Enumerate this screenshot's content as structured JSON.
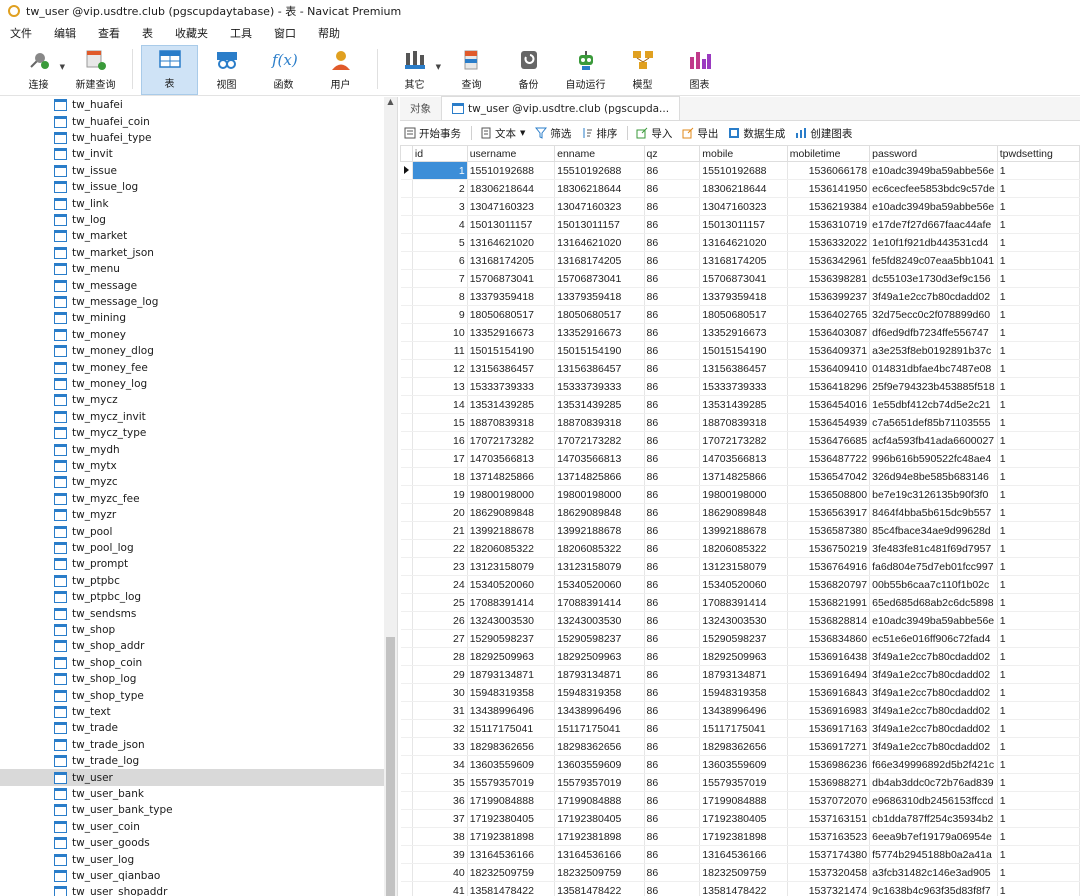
{
  "window": {
    "title": "tw_user @vip.usdtre.club (pgscupdaytabase) - 表 - Navicat Premium"
  },
  "menu": [
    "文件",
    "编辑",
    "查看",
    "表",
    "收藏夹",
    "工具",
    "窗口",
    "帮助"
  ],
  "toolbar": [
    {
      "label": "连接",
      "icon": "connect-icon"
    },
    {
      "label": "新建查询",
      "icon": "new-query-icon"
    },
    {
      "label": "表",
      "icon": "table-icon"
    },
    {
      "label": "视图",
      "icon": "view-icon"
    },
    {
      "label": "函数",
      "icon": "function-icon"
    },
    {
      "label": "用户",
      "icon": "user-icon"
    },
    {
      "label": "其它",
      "icon": "other-icon"
    },
    {
      "label": "查询",
      "icon": "query-icon"
    },
    {
      "label": "备份",
      "icon": "backup-icon"
    },
    {
      "label": "自动运行",
      "icon": "automation-icon"
    },
    {
      "label": "模型",
      "icon": "model-icon"
    },
    {
      "label": "图表",
      "icon": "chart-icon"
    }
  ],
  "sidebar": {
    "items": [
      "tw_huafei",
      "tw_huafei_coin",
      "tw_huafei_type",
      "tw_invit",
      "tw_issue",
      "tw_issue_log",
      "tw_link",
      "tw_log",
      "tw_market",
      "tw_market_json",
      "tw_menu",
      "tw_message",
      "tw_message_log",
      "tw_mining",
      "tw_money",
      "tw_money_dlog",
      "tw_money_fee",
      "tw_money_log",
      "tw_mycz",
      "tw_mycz_invit",
      "tw_mycz_type",
      "tw_mydh",
      "tw_mytx",
      "tw_myzc",
      "tw_myzc_fee",
      "tw_myzr",
      "tw_pool",
      "tw_pool_log",
      "tw_prompt",
      "tw_ptpbc",
      "tw_ptpbc_log",
      "tw_sendsms",
      "tw_shop",
      "tw_shop_addr",
      "tw_shop_coin",
      "tw_shop_log",
      "tw_shop_type",
      "tw_text",
      "tw_trade",
      "tw_trade_json",
      "tw_trade_log",
      "tw_user",
      "tw_user_bank",
      "tw_user_bank_type",
      "tw_user_coin",
      "tw_user_goods",
      "tw_user_log",
      "tw_user_qianbao",
      "tw_user_shopaddr"
    ],
    "selected": "tw_user"
  },
  "tabs": [
    {
      "label": "对象"
    },
    {
      "label": "tw_user @vip.usdtre.club (pgscupda..."
    }
  ],
  "subtoolbar": {
    "begin": "开始事务",
    "text": "文本",
    "filter": "筛选",
    "sort": "排序",
    "import": "导入",
    "export": "导出",
    "datagen": "数据生成",
    "chart": "创建图表"
  },
  "grid": {
    "columns": [
      "id",
      "username",
      "enname",
      "qz",
      "mobile",
      "mobiletime",
      "password",
      "tpwdsetting"
    ],
    "rows": [
      [
        "1",
        "15510192688",
        "15510192688",
        "86",
        "15510192688",
        "1536066178",
        "e10adc3949ba59abbe56e",
        "1"
      ],
      [
        "2",
        "18306218644",
        "18306218644",
        "86",
        "18306218644",
        "1536141950",
        "ec6cecfee5853bdc9c57de",
        "1"
      ],
      [
        "3",
        "13047160323",
        "13047160323",
        "86",
        "13047160323",
        "1536219384",
        "e10adc3949ba59abbe56e",
        "1"
      ],
      [
        "4",
        "15013011157",
        "15013011157",
        "86",
        "15013011157",
        "1536310719",
        "e17de7f27d667faac44afe",
        "1"
      ],
      [
        "5",
        "13164621020",
        "13164621020",
        "86",
        "13164621020",
        "1536332022",
        "1e10f1f921db443531cd4",
        "1"
      ],
      [
        "6",
        "13168174205",
        "13168174205",
        "86",
        "13168174205",
        "1536342961",
        "fe5fd8249c07eaa5bb1041",
        "1"
      ],
      [
        "7",
        "15706873041",
        "15706873041",
        "86",
        "15706873041",
        "1536398281",
        "dc55103e1730d3ef9c156",
        "1"
      ],
      [
        "8",
        "13379359418",
        "13379359418",
        "86",
        "13379359418",
        "1536399237",
        "3f49a1e2cc7b80cdadd02",
        "1"
      ],
      [
        "9",
        "18050680517",
        "18050680517",
        "86",
        "18050680517",
        "1536402765",
        "32d75ecc0c2f078899d60",
        "1"
      ],
      [
        "10",
        "13352916673",
        "13352916673",
        "86",
        "13352916673",
        "1536403087",
        "df6ed9dfb7234ffe556747",
        "1"
      ],
      [
        "11",
        "15015154190",
        "15015154190",
        "86",
        "15015154190",
        "1536409371",
        "a3e253f8eb0192891b37c",
        "1"
      ],
      [
        "12",
        "13156386457",
        "13156386457",
        "86",
        "13156386457",
        "1536409410",
        "014831dbfae4bc7487e08",
        "1"
      ],
      [
        "13",
        "15333739333",
        "15333739333",
        "86",
        "15333739333",
        "1536418296",
        "25f9e794323b453885f518",
        "1"
      ],
      [
        "14",
        "13531439285",
        "13531439285",
        "86",
        "13531439285",
        "1536454016",
        "1e55dbf412cb74d5e2c21",
        "1"
      ],
      [
        "15",
        "18870839318",
        "18870839318",
        "86",
        "18870839318",
        "1536454939",
        "c7a5651def85b71103555",
        "1"
      ],
      [
        "16",
        "17072173282",
        "17072173282",
        "86",
        "17072173282",
        "1536476685",
        "acf4a593fb41ada6600027",
        "1"
      ],
      [
        "17",
        "14703566813",
        "14703566813",
        "86",
        "14703566813",
        "1536487722",
        "996b616b590522fc48ae4",
        "1"
      ],
      [
        "18",
        "13714825866",
        "13714825866",
        "86",
        "13714825866",
        "1536547042",
        "326d94e8be585b683146",
        "1"
      ],
      [
        "19",
        "19800198000",
        "19800198000",
        "86",
        "19800198000",
        "1536508800",
        "be7e19c3126135b90f3f0",
        "1"
      ],
      [
        "20",
        "18629089848",
        "18629089848",
        "86",
        "18629089848",
        "1536563917",
        "8464f4bba5b615dc9b557",
        "1"
      ],
      [
        "21",
        "13992188678",
        "13992188678",
        "86",
        "13992188678",
        "1536587380",
        "85c4fbace34ae9d99628d",
        "1"
      ],
      [
        "22",
        "18206085322",
        "18206085322",
        "86",
        "18206085322",
        "1536750219",
        "3fe483fe81c481f69d7957",
        "1"
      ],
      [
        "23",
        "13123158079",
        "13123158079",
        "86",
        "13123158079",
        "1536764916",
        "fa6d804e75d7eb01fcc997",
        "1"
      ],
      [
        "24",
        "15340520060",
        "15340520060",
        "86",
        "15340520060",
        "1536820797",
        "00b55b6caa7c110f1b02c",
        "1"
      ],
      [
        "25",
        "17088391414",
        "17088391414",
        "86",
        "17088391414",
        "1536821991",
        "65ed685d68ab2c6dc5898",
        "1"
      ],
      [
        "26",
        "13243003530",
        "13243003530",
        "86",
        "13243003530",
        "1536828814",
        "e10adc3949ba59abbe56e",
        "1"
      ],
      [
        "27",
        "15290598237",
        "15290598237",
        "86",
        "15290598237",
        "1536834860",
        "ec51e6e016ff906c72fad4",
        "1"
      ],
      [
        "28",
        "18292509963",
        "18292509963",
        "86",
        "18292509963",
        "1536916438",
        "3f49a1e2cc7b80cdadd02",
        "1"
      ],
      [
        "29",
        "18793134871",
        "18793134871",
        "86",
        "18793134871",
        "1536916494",
        "3f49a1e2cc7b80cdadd02",
        "1"
      ],
      [
        "30",
        "15948319358",
        "15948319358",
        "86",
        "15948319358",
        "1536916843",
        "3f49a1e2cc7b80cdadd02",
        "1"
      ],
      [
        "31",
        "13438996496",
        "13438996496",
        "86",
        "13438996496",
        "1536916983",
        "3f49a1e2cc7b80cdadd02",
        "1"
      ],
      [
        "32",
        "15117175041",
        "15117175041",
        "86",
        "15117175041",
        "1536917163",
        "3f49a1e2cc7b80cdadd02",
        "1"
      ],
      [
        "33",
        "18298362656",
        "18298362656",
        "86",
        "18298362656",
        "1536917271",
        "3f49a1e2cc7b80cdadd02",
        "1"
      ],
      [
        "34",
        "13603559609",
        "13603559609",
        "86",
        "13603559609",
        "1536986236",
        "f66e349996892d5b2f421c",
        "1"
      ],
      [
        "35",
        "15579357019",
        "15579357019",
        "86",
        "15579357019",
        "1536988271",
        "db4ab3ddc0c72b76ad839",
        "1"
      ],
      [
        "36",
        "17199084888",
        "17199084888",
        "86",
        "17199084888",
        "1537072070",
        "e9686310db2456153ffccd",
        "1"
      ],
      [
        "37",
        "17192380405",
        "17192380405",
        "86",
        "17192380405",
        "1537163151",
        "cb1dda787ff254c35934b2",
        "1"
      ],
      [
        "38",
        "17192381898",
        "17192381898",
        "86",
        "17192381898",
        "1537163523",
        "6eea9b7ef19179a06954e",
        "1"
      ],
      [
        "39",
        "13164536166",
        "13164536166",
        "86",
        "13164536166",
        "1537174380",
        "f5774b2945188b0a2a41a",
        "1"
      ],
      [
        "40",
        "18232509759",
        "18232509759",
        "86",
        "18232509759",
        "1537320458",
        "a3fcb31482c146e3ad905",
        "1"
      ],
      [
        "41",
        "13581478422",
        "13581478422",
        "86",
        "13581478422",
        "1537321474",
        "9c1638b4c963f35d83f8f7",
        "1"
      ]
    ]
  },
  "colors": {
    "accent": "#3c8ed8",
    "selected_tool": "#cfe3f6"
  }
}
